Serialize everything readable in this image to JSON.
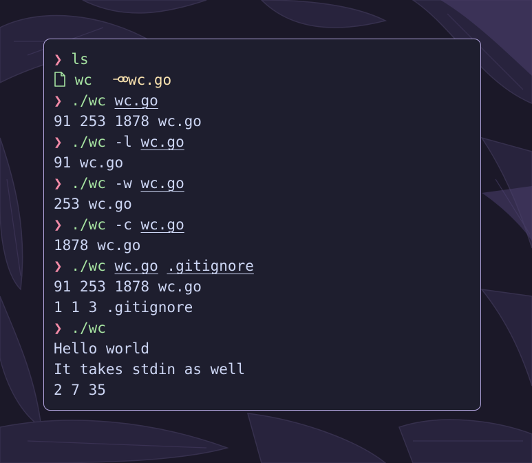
{
  "terminal": {
    "prompt_symbol": "❯",
    "entries": [
      {
        "cmd": "ls",
        "args": []
      },
      {
        "listing": [
          {
            "name": "wc",
            "icon": "file-icon",
            "color": "#a6e3a1"
          },
          {
            "name": "wc.go",
            "icon": "go-icon",
            "color": "#f9e2af"
          }
        ]
      },
      {
        "cmd": "./wc",
        "args": [
          {
            "text": "wc.go",
            "path": true
          }
        ]
      },
      {
        "output": "91 253 1878 wc.go"
      },
      {
        "cmd": "./wc",
        "args": [
          {
            "text": "-l",
            "path": false
          },
          {
            "text": "wc.go",
            "path": true
          }
        ]
      },
      {
        "output": "91 wc.go"
      },
      {
        "cmd": "./wc",
        "args": [
          {
            "text": "-w",
            "path": false
          },
          {
            "text": "wc.go",
            "path": true
          }
        ]
      },
      {
        "output": "253 wc.go"
      },
      {
        "cmd": "./wc",
        "args": [
          {
            "text": "-c",
            "path": false
          },
          {
            "text": "wc.go",
            "path": true
          }
        ]
      },
      {
        "output": "1878 wc.go"
      },
      {
        "cmd": "./wc",
        "args": [
          {
            "text": "wc.go",
            "path": true
          },
          {
            "text": ".gitignore",
            "path": true
          }
        ]
      },
      {
        "output": "91 253 1878 wc.go"
      },
      {
        "output": "1 1 3 .gitignore"
      },
      {
        "cmd": "./wc",
        "args": []
      },
      {
        "output": "Hello world"
      },
      {
        "output": "It takes stdin as well"
      },
      {
        "output": "2 7 35"
      }
    ]
  },
  "colors": {
    "background": "#1e1e2e",
    "border": "#b4a6e0",
    "prompt": "#f38ba8",
    "command": "#a6e3a1",
    "text": "#cdd6f4",
    "go_file": "#f9e2af"
  }
}
